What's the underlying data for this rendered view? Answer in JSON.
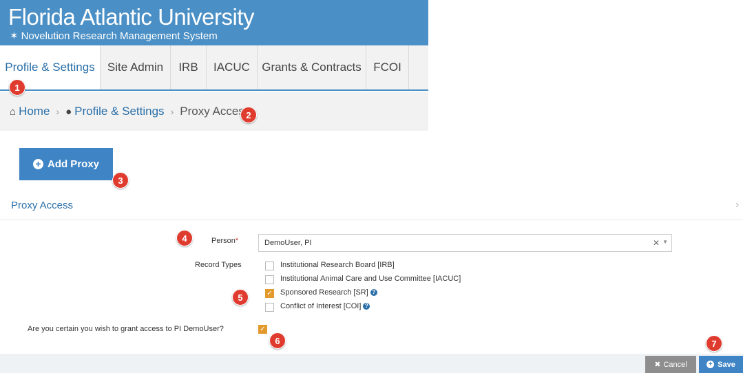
{
  "header": {
    "university": "Florida Atlantic University",
    "system": "Novelution Research Management System",
    "logo_icon": "star-icon",
    "brand_color": "#4a8fc5"
  },
  "tabs": [
    {
      "label": "Profile & Settings",
      "active": true
    },
    {
      "label": "Site Admin",
      "active": false
    },
    {
      "label": "IRB",
      "active": false
    },
    {
      "label": "IACUC",
      "active": false
    },
    {
      "label": "Grants & Contracts",
      "active": false
    },
    {
      "label": "FCOI",
      "active": false
    }
  ],
  "breadcrumb": {
    "home": "Home",
    "profile": "Profile & Settings",
    "current": "Proxy Access"
  },
  "add_proxy_label": "Add Proxy",
  "section_title": "Proxy Access",
  "form": {
    "person_label": "Person",
    "person_required": "*",
    "person_value": "DemoUser, PI",
    "record_types_label": "Record Types",
    "record_types": [
      {
        "label": "Institutional Research Board [IRB]",
        "checked": false,
        "help": false
      },
      {
        "label": "Institutional Animal Care and Use Committee [IACUC]",
        "checked": false,
        "help": false
      },
      {
        "label": "Sponsored Research [SR]",
        "checked": true,
        "help": true
      },
      {
        "label": "Conflict of Interest [COI]",
        "checked": false,
        "help": true
      }
    ],
    "confirm_label": "Are you certain you wish to grant access to PI DemoUser?",
    "confirm_checked": true
  },
  "footer": {
    "cancel_label": "Cancel",
    "save_label": "Save"
  },
  "badges": [
    "1",
    "2",
    "3",
    "4",
    "5",
    "6",
    "7"
  ]
}
